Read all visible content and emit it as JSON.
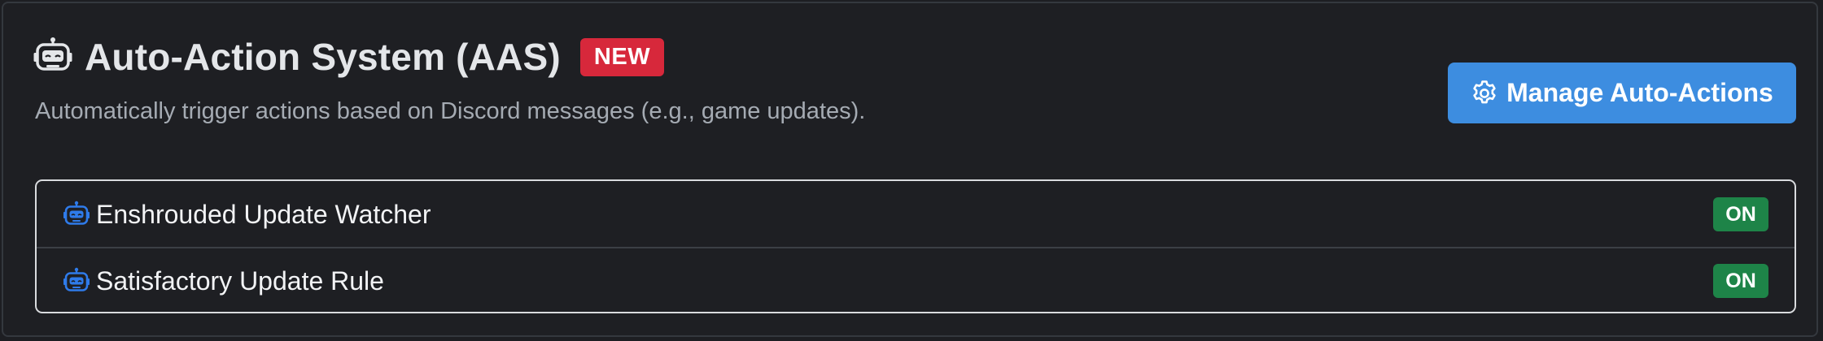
{
  "panel": {
    "title_icon": "robot-icon",
    "title": "Auto-Action System (AAS)",
    "badge": "NEW",
    "badge_color": "#d7283b",
    "subtitle": "Automatically trigger actions based on Discord messages (e.g., game updates).",
    "manage_button": {
      "icon": "gear-icon",
      "label": "Manage Auto-Actions",
      "color": "#3d8de0"
    }
  },
  "rules": [
    {
      "icon": "robot-icon",
      "name": "Enshrouded Update Watcher",
      "status": "ON"
    },
    {
      "icon": "robot-icon",
      "name": "Satisfactory Update Rule",
      "status": "ON"
    }
  ],
  "colors": {
    "status_on": "#1e8448",
    "rule_icon": "#2f7bea"
  }
}
